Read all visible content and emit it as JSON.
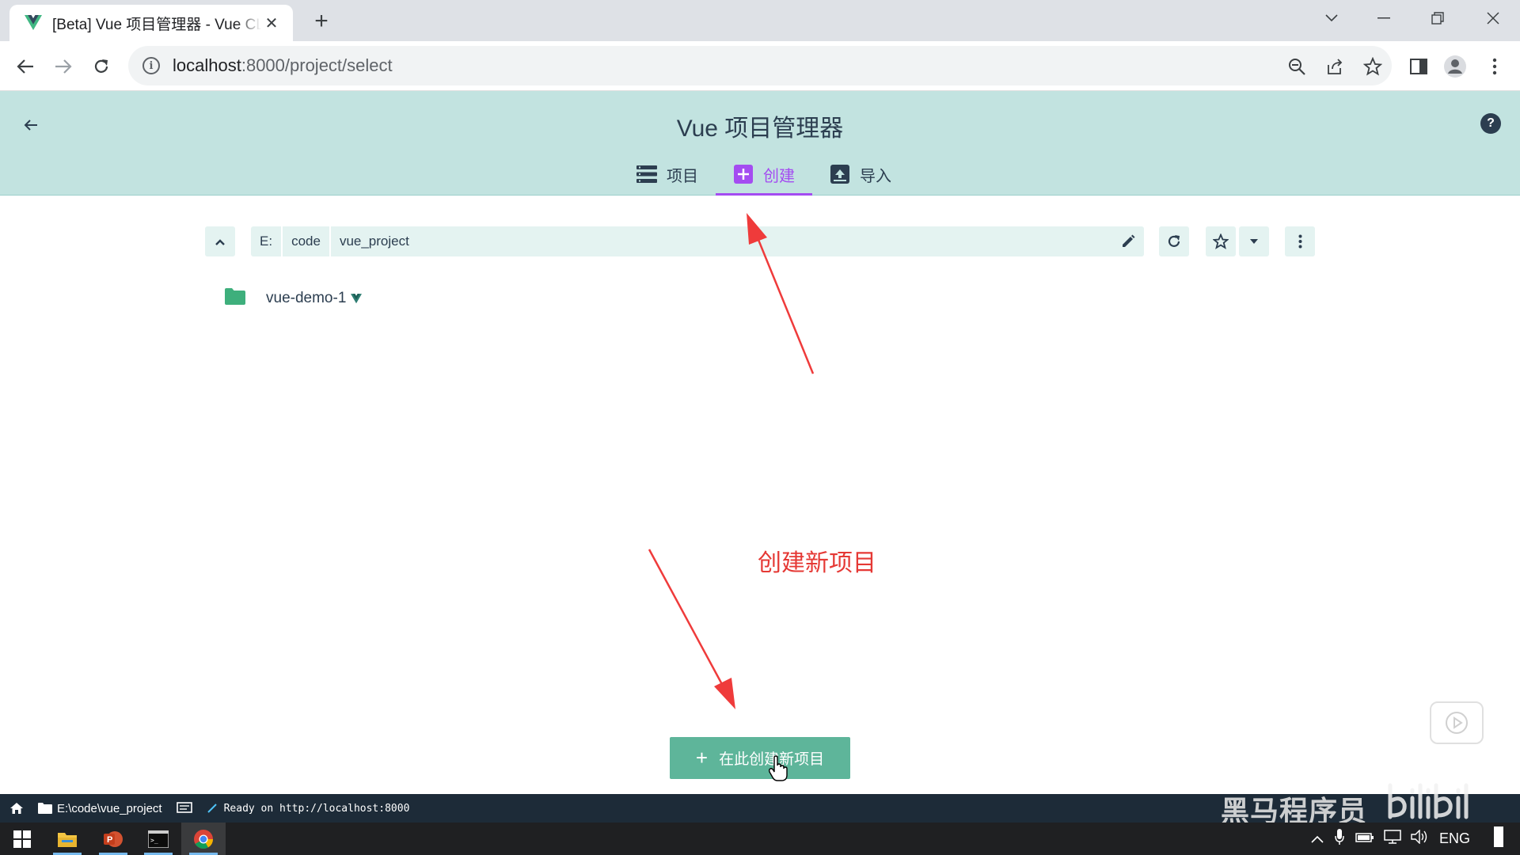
{
  "browser": {
    "tab_title": "[Beta] Vue 项目管理器 - Vue CLI",
    "url_host": "localhost",
    "url_rest": ":8000/project/select"
  },
  "app": {
    "title": "Vue 项目管理器",
    "nav_tabs": [
      {
        "label": "项目",
        "icon": "list-icon"
      },
      {
        "label": "创建",
        "icon": "add-box-icon",
        "active": true
      },
      {
        "label": "导入",
        "icon": "import-icon"
      }
    ],
    "path_segments": [
      "E:",
      "code",
      "vue_project"
    ],
    "folders": [
      {
        "name": "vue-demo-1",
        "has_vue_badge": true
      }
    ],
    "create_button_label": "在此创建新项目",
    "accent_color": "#a44cf1",
    "header_color": "#c2e3e0"
  },
  "annotation": {
    "text": "创建新项目",
    "color": "#e53935"
  },
  "statusbar": {
    "path": "E:\\code\\vue_project",
    "log": "Ready on http://localhost:8000"
  },
  "watermark": {
    "text": "黑马程序员"
  },
  "taskbar": {
    "lang": "ENG"
  }
}
